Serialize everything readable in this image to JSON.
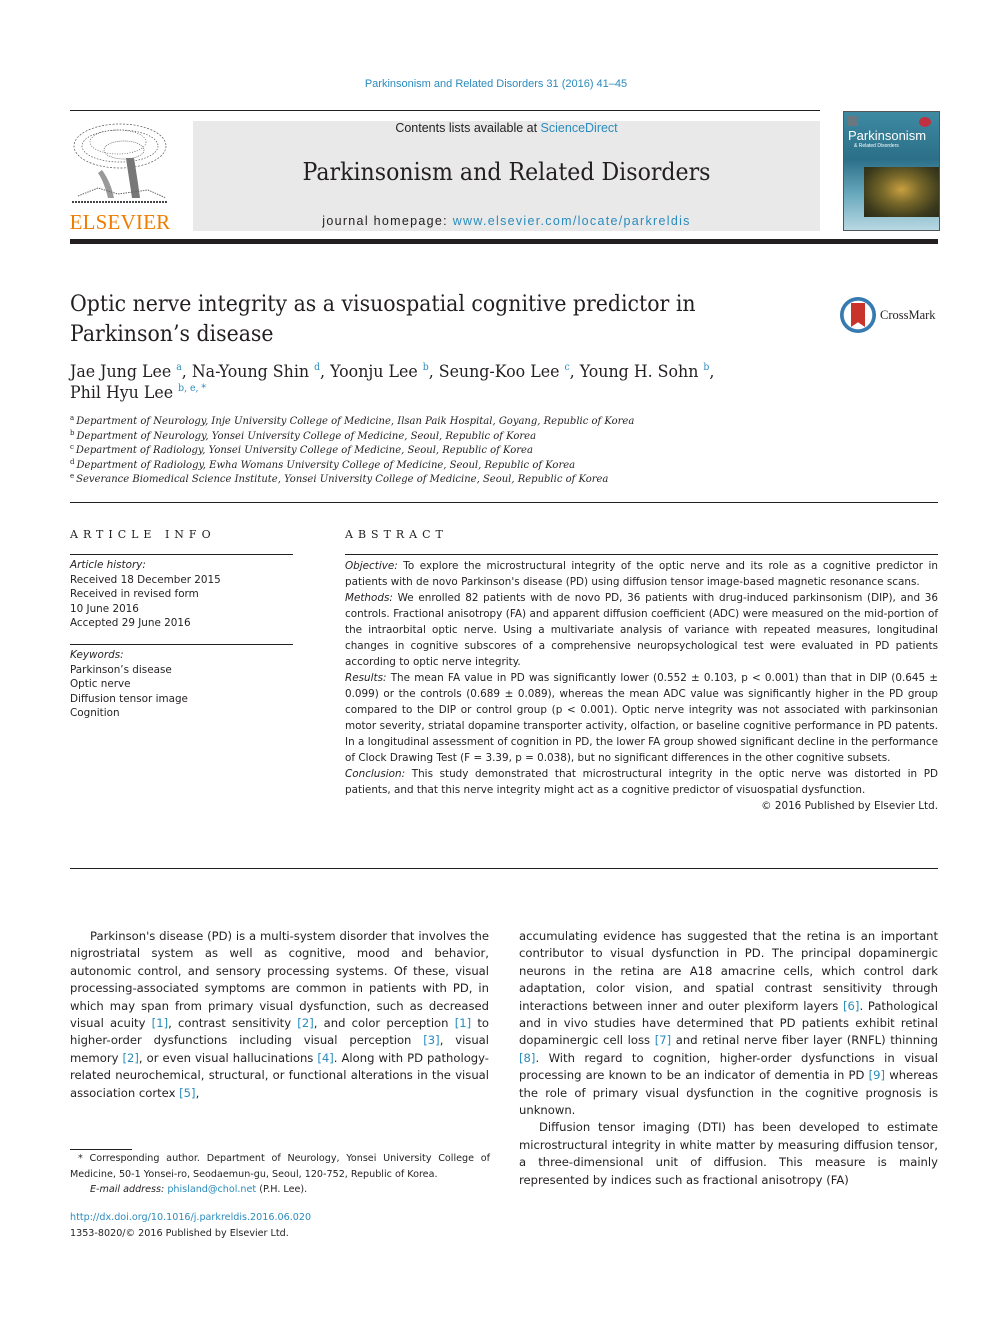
{
  "running_head": "Parkinsonism and Related Disorders 31 (2016) 41–45",
  "publisher": {
    "logo_word": "ELSEVIER",
    "logo_color": "#f07d00"
  },
  "banner": {
    "contents_prefix": "Contents lists available at ",
    "contents_link": "ScienceDirect",
    "journal_name": "Parkinsonism and Related Disorders",
    "homepage_prefix": "journal homepage: ",
    "homepage_link": "www.elsevier.com/locate/parkreldis"
  },
  "cover": {
    "title": "Parkinsonism",
    "subtitle": "& Related Disorders"
  },
  "crossmark_label": "CrossMark",
  "article": {
    "title_line1": "Optic nerve integrity as a visuospatial cognitive predictor in",
    "title_line2": "Parkinson’s disease",
    "authors": [
      {
        "name": "Jae Jung Lee",
        "aff": "a",
        "sep": ", "
      },
      {
        "name": "Na-Young Shin",
        "aff": "d",
        "sep": ", "
      },
      {
        "name": "Yoonju Lee",
        "aff": "b",
        "sep": ", "
      },
      {
        "name": "Seung-Koo Lee",
        "aff": "c",
        "sep": ", "
      },
      {
        "name": "Young H. Sohn",
        "aff": "b",
        "sep": ","
      },
      {
        "name": "Phil Hyu Lee",
        "aff": "b, e, *",
        "sep": ""
      }
    ],
    "affiliations": [
      {
        "mark": "a",
        "text": "Department of Neurology, Inje University College of Medicine, Ilsan Paik Hospital, Goyang, Republic of Korea"
      },
      {
        "mark": "b",
        "text": "Department of Neurology, Yonsei University College of Medicine, Seoul, Republic of Korea"
      },
      {
        "mark": "c",
        "text": "Department of Radiology, Yonsei University College of Medicine, Seoul, Republic of Korea"
      },
      {
        "mark": "d",
        "text": "Department of Radiology, Ewha Womans University College of Medicine, Seoul, Republic of Korea"
      },
      {
        "mark": "e",
        "text": "Severance Biomedical Science Institute, Yonsei University College of Medicine, Seoul, Republic of Korea"
      }
    ]
  },
  "article_info": {
    "heading": "ARTICLE INFO",
    "history_label": "Article history:",
    "history": [
      "Received 18 December 2015",
      "Received in revised form",
      "10 June 2016",
      "Accepted 29 June 2016"
    ],
    "keywords_label": "Keywords:",
    "keywords": [
      "Parkinson’s disease",
      "Optic nerve",
      "Diffusion tensor image",
      "Cognition"
    ]
  },
  "abstract": {
    "heading": "ABSTRACT",
    "sections": [
      {
        "label": "Objective:",
        "text": " To explore the microstructural integrity of the optic nerve and its role as a cognitive predictor in patients with de novo Parkinson's disease (PD) using diffusion tensor image-based magnetic resonance scans."
      },
      {
        "label": "Methods:",
        "text": " We enrolled 82 patients with de novo PD, 36 patients with drug-induced parkinsonism (DIP), and 36 controls. Fractional anisotropy (FA) and apparent diffusion coefficient (ADC) were measured on the mid-portion of the intraorbital optic nerve. Using a multivariate analysis of variance with repeated measures, longitudinal changes in cognitive subscores of a comprehensive neuropsychological test were evaluated in PD patients according to optic nerve integrity."
      },
      {
        "label": "Results:",
        "text": " The mean FA value in PD was significantly lower (0.552 ± 0.103, p < 0.001) than that in DIP (0.645 ± 0.099) or the controls (0.689 ± 0.089), whereas the mean ADC value was significantly higher in the PD group compared to the DIP or control group (p < 0.001). Optic nerve integrity was not associated with parkinsonian motor severity, striatal dopamine transporter activity, olfaction, or baseline cognitive performance in PD patents. In a longitudinal assessment of cognition in PD, the lower FA group showed significant decline in the performance of Clock Drawing Test (F = 3.39, p = 0.038), but no significant differences in the other cognitive subsets."
      },
      {
        "label": "Conclusion:",
        "text": " This study demonstrated that microstructural integrity in the optic nerve was distorted in PD patients, and that this nerve integrity might act as a cognitive predictor of visuospatial dysfunction."
      }
    ],
    "copyright": "© 2016 Published by Elsevier Ltd."
  },
  "body": {
    "left": [
      "Parkinson's disease (PD) is a multi-system disorder that involves the nigrostriatal system as well as cognitive, mood and behavior, autonomic control, and sensory processing systems. Of these, visual processing-associated symptoms are common in patients with PD, in which may span from primary visual dysfunction, such as decreased visual acuity ",
      "[1]",
      ", contrast sensitivity ",
      "[2]",
      ", and color perception ",
      "[1]",
      " to higher-order dysfunctions including visual perception ",
      "[3]",
      ", visual memory ",
      "[2]",
      ", or even visual hallucinations ",
      "[4]",
      ". Along with PD pathology-related neurochemical, structural, or functional alterations in the visual association cortex ",
      "[5]",
      ","
    ],
    "right_p1": [
      "accumulating evidence has suggested that the retina is an important contributor to visual dysfunction in PD. The principal dopaminergic neurons in the retina are A18 amacrine cells, which control dark adaptation, color vision, and spatial contrast sensitivity through interactions between inner and outer plexiform layers ",
      "[6]",
      ". Pathological and in vivo studies have determined that PD patients exhibit retinal dopaminergic cell loss ",
      "[7]",
      " and retinal nerve fiber layer (RNFL) thinning ",
      "[8]",
      ". With regard to cognition, higher-order dysfunctions in visual processing are known to be an indicator of dementia in PD ",
      "[9]",
      " whereas the role of primary visual dysfunction in the cognitive prognosis is unknown."
    ],
    "right_p2": "Diffusion tensor imaging (DTI) has been developed to estimate microstructural integrity in white matter by measuring diffusion tensor, a three-dimensional unit of diffusion. This measure is mainly represented by indices such as fractional anisotropy (FA)"
  },
  "footnote": {
    "corresponding": "* Corresponding author. Department of Neurology, Yonsei University College of Medicine, 50-1 Yonsei-ro, Seodaemun-gu, Seoul, 120-752, Republic of Korea.",
    "email_label": "E-mail address:",
    "email": "phisland@chol.net",
    "email_suffix": " (P.H. Lee)."
  },
  "doi": "http://dx.doi.org/10.1016/j.parkreldis.2016.06.020",
  "issn_line": "1353-8020/© 2016 Published by Elsevier Ltd.",
  "colors": {
    "link": "#2a8bbd",
    "text": "#231f20",
    "banner_bg": "#e9e9e9"
  }
}
